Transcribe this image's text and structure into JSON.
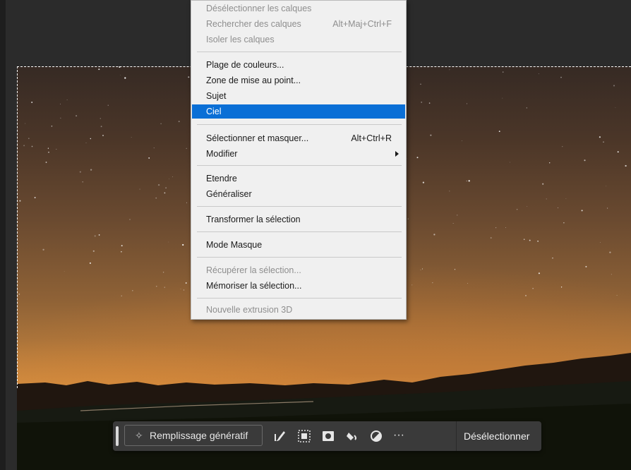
{
  "menu": {
    "items": [
      {
        "label": "Désélectionner les calques",
        "shortcut": "",
        "disabled": true
      },
      {
        "label": "Rechercher des calques",
        "shortcut": "Alt+Maj+Ctrl+F",
        "disabled": true
      },
      {
        "label": "Isoler les calques",
        "shortcut": "",
        "disabled": true
      },
      {
        "label": "Plage de couleurs...",
        "shortcut": "",
        "disabled": false
      },
      {
        "label": "Zone de mise au point...",
        "shortcut": "",
        "disabled": false
      },
      {
        "label": "Sujet",
        "shortcut": "",
        "disabled": false
      },
      {
        "label": "Ciel",
        "shortcut": "",
        "disabled": false,
        "highlighted": true
      },
      {
        "label": "Sélectionner et masquer...",
        "shortcut": "Alt+Ctrl+R",
        "disabled": false
      },
      {
        "label": "Modifier",
        "shortcut": "",
        "disabled": false,
        "submenu": true
      },
      {
        "label": "Etendre",
        "shortcut": "",
        "disabled": false
      },
      {
        "label": "Généraliser",
        "shortcut": "",
        "disabled": false
      },
      {
        "label": "Transformer la sélection",
        "shortcut": "",
        "disabled": false
      },
      {
        "label": "Mode Masque",
        "shortcut": "",
        "disabled": false
      },
      {
        "label": "Récupérer la sélection...",
        "shortcut": "",
        "disabled": true
      },
      {
        "label": "Mémoriser la sélection...",
        "shortcut": "",
        "disabled": false
      },
      {
        "label": "Nouvelle extrusion 3D",
        "shortcut": "",
        "disabled": true
      }
    ]
  },
  "taskbar": {
    "generative_fill": "Remplissage génératif",
    "more": "···",
    "deselect": "Désélectionner",
    "icons": [
      "brush-modify-icon",
      "invert-selection-icon",
      "mask-icon",
      "fill-bucket-icon",
      "adjustment-icon",
      "more-icon"
    ]
  },
  "colors": {
    "highlight": "#0a6fd6",
    "menu_bg": "#f0f0f0",
    "taskbar_bg": "#3a3a3a",
    "workspace_bg": "#2b2b2b"
  }
}
